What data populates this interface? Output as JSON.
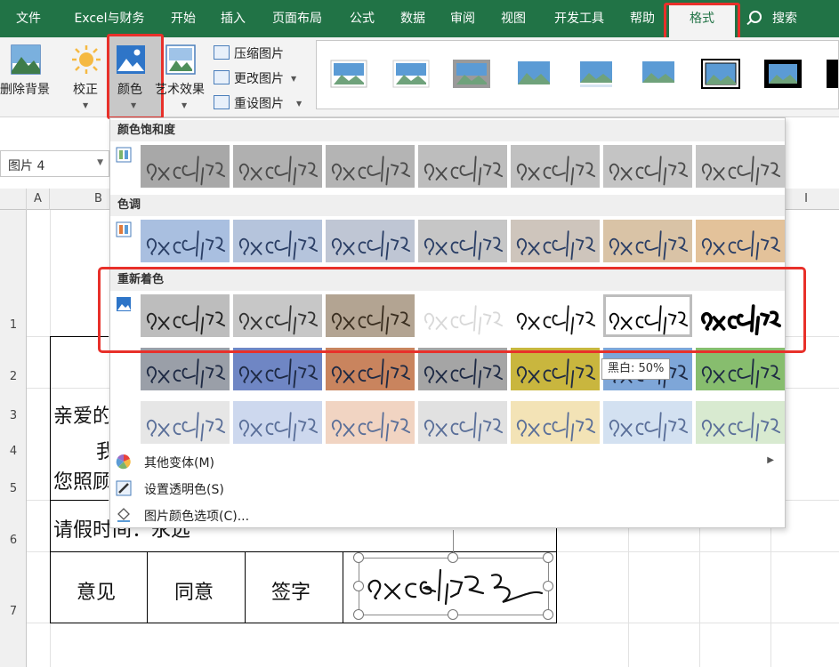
{
  "menu": {
    "tabs": [
      "文件",
      "Excel与财务",
      "开始",
      "插入",
      "页面布局",
      "公式",
      "数据",
      "审阅",
      "视图",
      "开发工具",
      "帮助",
      "格式"
    ],
    "active_tab": "格式",
    "search_label": "搜索"
  },
  "ribbon": {
    "remove_bg": "删除背景",
    "corrections": "校正",
    "color": "颜色",
    "artistic": "艺术效果",
    "compress": "压缩图片",
    "change_picture": "更改图片",
    "reset_picture": "重设图片"
  },
  "namebox": {
    "value": "图片 4"
  },
  "sheet": {
    "columns": [
      "A",
      "B",
      "I"
    ],
    "rows": [
      "1",
      "2",
      "3",
      "4",
      "5",
      "6",
      "7"
    ],
    "cells": {
      "r3": "亲爱的",
      "r4": "我",
      "r5": "您照顾",
      "r6": "请假时间：永远",
      "r7_label1": "意见",
      "r7_label2": "同意",
      "r7_label3": "签字"
    }
  },
  "color_menu": {
    "section_saturation": "颜色饱和度",
    "section_tone": "色调",
    "section_recolor": "重新着色",
    "tooltip": "黑白: 50%",
    "more_variations": "其他变体(M)",
    "set_transparent": "设置透明色(S)",
    "color_options": "图片颜色选项(C)...",
    "saturation_colors": [
      "#a8a8a8",
      "#b0b0b0",
      "#b4b4b4",
      "#bdbdbd",
      "#c0c0c0",
      "#c4c4c4",
      "#c6c6c6"
    ],
    "tone_colors": [
      "#a9bfe0",
      "#b5c4dc",
      "#bfc6d4",
      "#c6c6c6",
      "#cec5bc",
      "#d9c3a6",
      "#e3c29a"
    ],
    "recolor_row1": [
      "#bdbdbd",
      "#c7c7c7",
      "#b3a492",
      "#ffffff",
      "#ffffff",
      "#ffffff",
      "#ffffff"
    ],
    "recolor_row2": [
      "#9a9fa8",
      "#6f86c4",
      "#c9845e",
      "#a5a5a5",
      "#c9b63e",
      "#7ea6d8",
      "#87bd6e"
    ],
    "recolor_row3": [
      "#e6e6e6",
      "#cdd8ee",
      "#f1d4c2",
      "#e1e1e1",
      "#f3e3b6",
      "#d3e1f1",
      "#d8ead0"
    ]
  },
  "accent": "#217346",
  "highlight": "#e8302a"
}
